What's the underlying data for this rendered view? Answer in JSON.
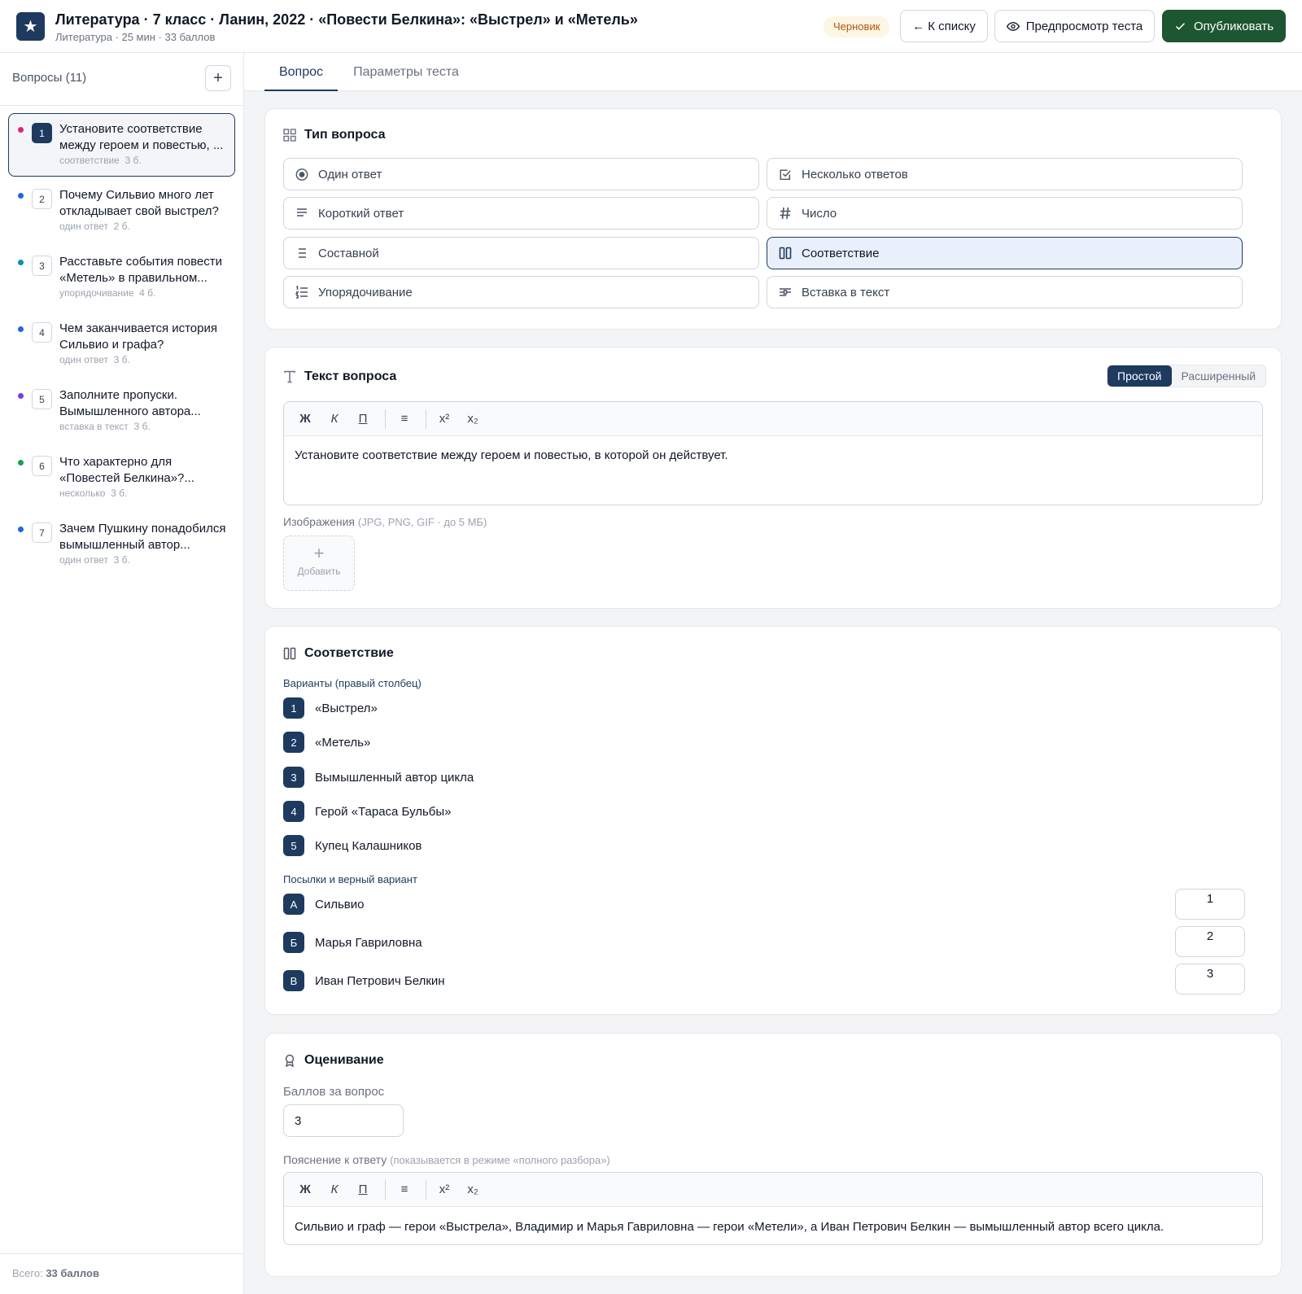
{
  "header": {
    "logo_glyph": "★",
    "title": "Литература · 7 класс · Ланин, 2022 · «Повести Белкина»: «Выстрел» и «Метель»",
    "subtitle": "Литература · 25 мин · 33 баллов",
    "status_badge": "Черновик",
    "back_label": "← К списку",
    "preview_label": "Предпросмотр теста",
    "publish_label": "Опубликовать"
  },
  "sidebar": {
    "title": "Вопросы (11)",
    "add_glyph": "+",
    "items": [
      {
        "num": "1",
        "text": "Установите соответствие между героем и повестью, ...",
        "type": "соответствие",
        "points": "3 б.",
        "dot_color": "#db2777",
        "active": true
      },
      {
        "num": "2",
        "text": "Почему Сильвио много лет откладывает свой выстрел?",
        "type": "один ответ",
        "points": "2 б.",
        "dot_color": "#2563eb",
        "active": false
      },
      {
        "num": "3",
        "text": "Расставьте события повести «Метель» в правильном...",
        "type": "упорядочивание",
        "points": "4 б.",
        "dot_color": "#0891b2",
        "active": false
      },
      {
        "num": "4",
        "text": "Чем заканчивается история Сильвио и графа?",
        "type": "один ответ",
        "points": "3 б.",
        "dot_color": "#2563eb",
        "active": false
      },
      {
        "num": "5",
        "text": "Заполните пропуски. Вымышленного автора...",
        "type": "вставка в текст",
        "points": "3 б.",
        "dot_color": "#7c3aed",
        "active": false
      },
      {
        "num": "6",
        "text": "Что характерно для «Повестей Белкина»?...",
        "type": "несколько",
        "points": "3 б.",
        "dot_color": "#16a34a",
        "active": false
      },
      {
        "num": "7",
        "text": "Зачем Пушкину понадобился вымышленный автор...",
        "type": "один ответ",
        "points": "3 б.",
        "dot_color": "#2563eb",
        "active": false
      }
    ],
    "total_prefix": "Всего:",
    "total_value": "33 баллов"
  },
  "tabs": [
    {
      "label": "Вопрос",
      "active": true
    },
    {
      "label": "Параметры теста",
      "active": false
    }
  ],
  "question_type": {
    "title": "Тип вопроса",
    "options": [
      {
        "label": "Один ответ",
        "icon": "radio-icon",
        "selected": false
      },
      {
        "label": "Несколько ответов",
        "icon": "checkbox-icon",
        "selected": false
      },
      {
        "label": "Короткий ответ",
        "icon": "lines-icon",
        "selected": false
      },
      {
        "label": "Число",
        "icon": "hash-icon",
        "selected": false
      },
      {
        "label": "Составной",
        "icon": "list-icon",
        "selected": false
      },
      {
        "label": "Соответствие",
        "icon": "columns-icon",
        "selected": true
      },
      {
        "label": "Упорядочивание",
        "icon": "ordered-list-icon",
        "selected": false
      },
      {
        "label": "Вставка в текст",
        "icon": "text-insert-icon",
        "selected": false
      }
    ]
  },
  "question_text": {
    "title": "Текст вопроса",
    "mode_simple": "Простой",
    "mode_advanced": "Расширенный",
    "toolbar": {
      "bold": "Ж",
      "italic": "К",
      "underline": "П",
      "list": "≡",
      "sup": "x²",
      "sub": "x₂"
    },
    "content": "Установите соответствие между героем и повестью, в которой он действует.",
    "images_label": "Изображения",
    "images_hint": "(JPG, PNG, GIF · до 5 МБ)",
    "add_glyph": "+",
    "add_label": "Добавить"
  },
  "matching": {
    "title": "Соответствие",
    "options_label": "Варианты (правый столбец)",
    "options": [
      {
        "num": "1",
        "text": "«Выстрел»"
      },
      {
        "num": "2",
        "text": "«Метель»"
      },
      {
        "num": "3",
        "text": "Вымышленный автор цикла"
      },
      {
        "num": "4",
        "text": "Герой «Тараса Бульбы»"
      },
      {
        "num": "5",
        "text": "Купец Калашников"
      }
    ],
    "premises_label": "Посылки и верный вариант",
    "premises": [
      {
        "letter": "А",
        "text": "Сильвио",
        "answer": "1"
      },
      {
        "letter": "Б",
        "text": "Марья Гавриловна",
        "answer": "2"
      },
      {
        "letter": "В",
        "text": "Иван Петрович Белкин",
        "answer": "3"
      }
    ]
  },
  "grading": {
    "title": "Оценивание",
    "points_label": "Баллов за вопрос",
    "points_value": "3",
    "explanation_label": "Пояснение к ответу",
    "explanation_hint": "(показывается в режиме «полного разбора»)",
    "toolbar": {
      "bold": "Ж",
      "italic": "К",
      "underline": "П",
      "list": "≡",
      "sup": "x²",
      "sub": "x₂"
    },
    "explanation": "Сильвио и граф — герои «Выстрела», Владимир и Марья Гавриловна — герои «Метели», а Иван Петрович Белкин — вымышленный автор всего цикла."
  }
}
